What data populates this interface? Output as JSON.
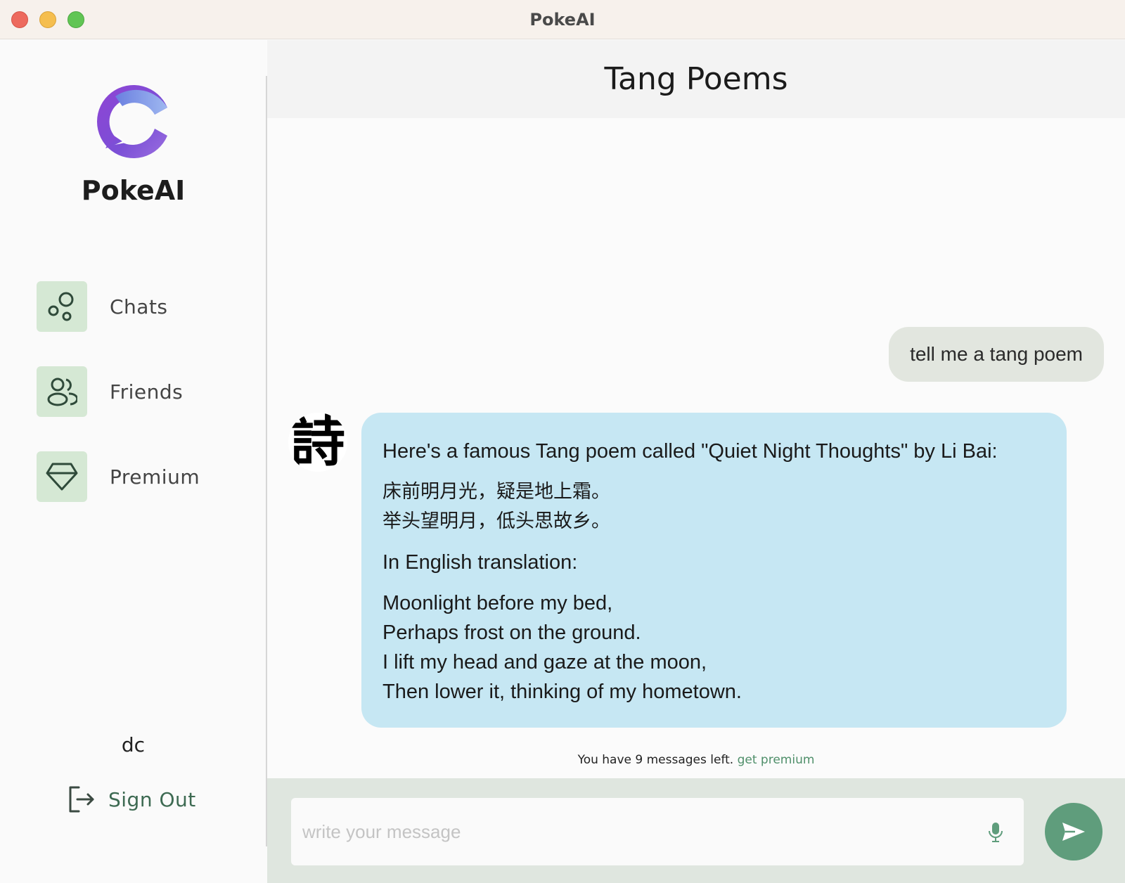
{
  "window": {
    "title": "PokeAI"
  },
  "sidebar": {
    "brand": "PokeAI",
    "nav": [
      {
        "label": "Chats",
        "icon": "bubbles-icon"
      },
      {
        "label": "Friends",
        "icon": "users-icon"
      },
      {
        "label": "Premium",
        "icon": "diamond-icon"
      }
    ],
    "username": "dc",
    "signout_label": "Sign Out"
  },
  "chat": {
    "title": "Tang Poems",
    "user_message": "tell me a tang poem",
    "bot_avatar_glyph": "詩",
    "bot_message": {
      "intro": "Here's a famous Tang poem called \"Quiet Night Thoughts\" by Li Bai:",
      "chinese_lines": [
        "床前明月光，疑是地上霜。",
        "举头望明月，低头思故乡。"
      ],
      "translation_heading": "In English translation:",
      "english_lines": [
        "Moonlight before my bed,",
        "Perhaps frost on the ground.",
        "I lift my head and gaze at the moon,",
        "Then lower it, thinking of my hometown."
      ]
    },
    "limit_text": "You have 9 messages left.",
    "limit_link": "get premium"
  },
  "composer": {
    "placeholder": "write your message",
    "value": ""
  },
  "colors": {
    "accent": "#5f9d7c",
    "nav_icon_bg": "#d5e8d4",
    "bot_bubble": "#c6e7f3",
    "user_bubble": "#e2e6df",
    "logo_purple": "#7b4fd6"
  }
}
